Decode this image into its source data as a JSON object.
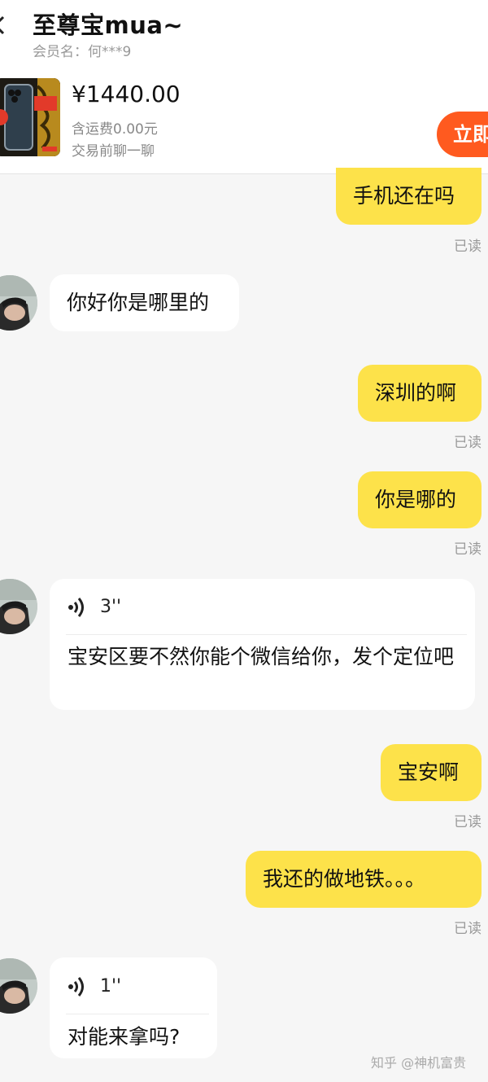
{
  "header": {
    "title": "至尊宝mua~",
    "member_label": "会员名：何***9",
    "price": "¥1440.00",
    "shipping": "含运费0.00元",
    "chat_note": "交易前聊一聊",
    "buy_button": "立即"
  },
  "messages": [
    {
      "side": "me",
      "text": "手机还在吗",
      "read": "已读"
    },
    {
      "side": "other",
      "text": "你好你是哪里的"
    },
    {
      "side": "me",
      "text": "深圳的啊",
      "read": "已读"
    },
    {
      "side": "me",
      "text": "你是哪的",
      "read": "已读"
    },
    {
      "side": "other",
      "type": "voice",
      "duration": "3''",
      "text": "宝安区要不然你能个微信给你，发个定位吧"
    },
    {
      "side": "me",
      "text": "宝安啊",
      "read": "已读"
    },
    {
      "side": "me",
      "text": "我还的做地铁。。。",
      "read": "已读"
    },
    {
      "side": "other",
      "type": "voice",
      "duration": "1''",
      "text": "对能来拿吗?"
    }
  ],
  "watermark": "知乎 @神机富贵",
  "colors": {
    "my_bubble": "#fde24a",
    "their_bubble": "#ffffff",
    "buy_button": "#ff5a1f",
    "background": "#f6f6f6"
  },
  "icons": {
    "back": "chevron-left-icon",
    "voice": "voice-wave-icon"
  }
}
